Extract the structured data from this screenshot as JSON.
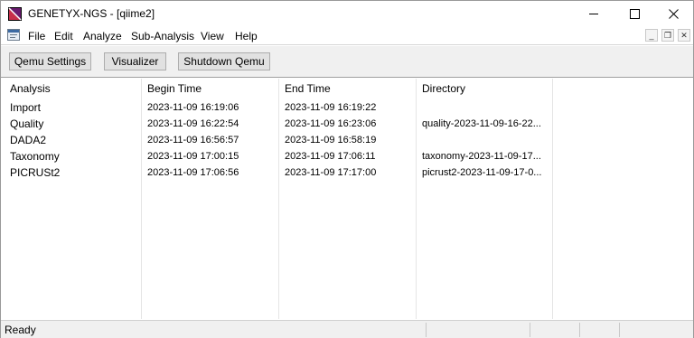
{
  "window": {
    "title": "GENETYX-NGS - [qiime2]"
  },
  "menu": {
    "items": [
      "File",
      "Edit",
      "Analyze",
      "Sub-Analysis",
      "View",
      "Help"
    ]
  },
  "toolbar": {
    "qemu_settings_label": "Qemu Settings",
    "visualizer_label": "Visualizer",
    "shutdown_label": "Shutdown Qemu"
  },
  "table": {
    "columns": [
      "Analysis",
      "Begin Time",
      "End Time",
      "Directory"
    ],
    "rows": [
      {
        "analysis": "Import",
        "begin": "2023-11-09 16:19:06",
        "end": "2023-11-09 16:19:22",
        "directory": ""
      },
      {
        "analysis": "Quality",
        "begin": "2023-11-09 16:22:54",
        "end": "2023-11-09 16:23:06",
        "directory": "quality-2023-11-09-16-22..."
      },
      {
        "analysis": "DADA2",
        "begin": "2023-11-09 16:56:57",
        "end": "2023-11-09 16:58:19",
        "directory": ""
      },
      {
        "analysis": "Taxonomy",
        "begin": "2023-11-09 17:00:15",
        "end": "2023-11-09 17:06:11",
        "directory": "taxonomy-2023-11-09-17..."
      },
      {
        "analysis": "PICRUSt2",
        "begin": "2023-11-09 17:06:56",
        "end": "2023-11-09 17:17:00",
        "directory": "picrust2-2023-11-09-17-0..."
      }
    ]
  },
  "status": {
    "text": "Ready"
  },
  "icons": {
    "app": "genetyx-app-icon",
    "document": "document-icon",
    "minimize": "minimize-icon",
    "maximize": "maximize-icon",
    "close": "close-icon",
    "mdi_minimize": "mdi-minimize-icon",
    "mdi_restore": "mdi-restore-icon",
    "mdi_close": "mdi-close-icon"
  },
  "colors": {
    "icon_accent": "#6a1b6f",
    "toolbar_bg": "#f0f0f0"
  }
}
